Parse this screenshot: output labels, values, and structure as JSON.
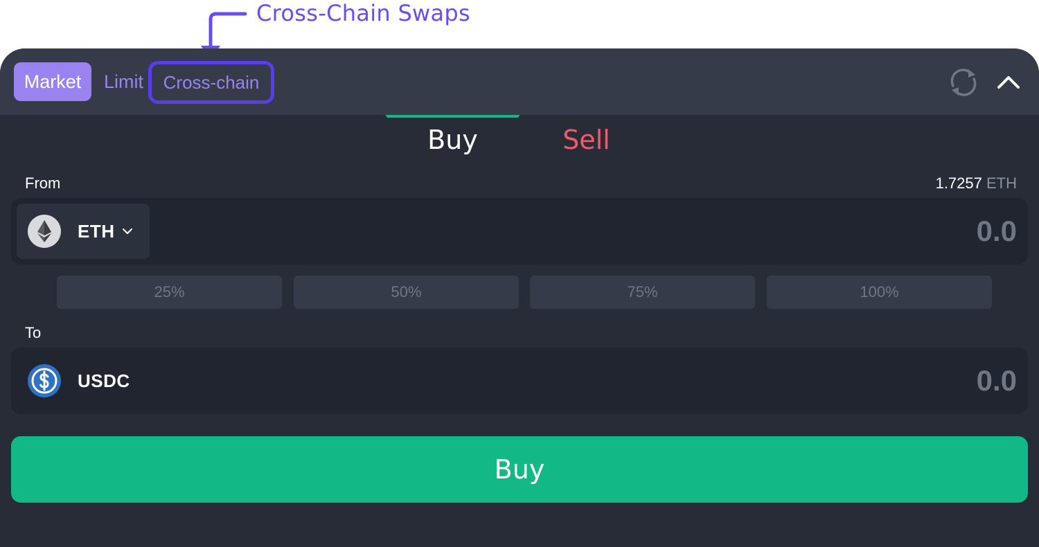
{
  "annotation": {
    "text": "Cross-Chain Swaps",
    "color": "#6b4cf0"
  },
  "order_tabs": {
    "market_label": "Market",
    "limit_label": "Limit",
    "cross_chain_label": "Cross-chain",
    "active": "Market"
  },
  "header_icons": [
    "refresh-icon",
    "chevron-up-icon"
  ],
  "side_tabs": {
    "buy_label": "Buy",
    "sell_label": "Sell",
    "active": "Buy"
  },
  "from": {
    "label": "From",
    "balance_value": "1.7257",
    "balance_unit": "ETH",
    "token": "ETH",
    "token_icon": "ethereum-icon",
    "amount": "0.0"
  },
  "percent_buttons": [
    "25%",
    "50%",
    "75%",
    "100%"
  ],
  "to": {
    "label": "To",
    "token": "USDC",
    "token_icon": "usdc-icon",
    "amount": "0.0"
  },
  "submit": {
    "label": "Buy"
  },
  "colors": {
    "accent": "#9b82f1",
    "buy": "#13b887",
    "sell": "#f2596b",
    "panel": "#272c37",
    "highlight": "#5a3cf0"
  }
}
